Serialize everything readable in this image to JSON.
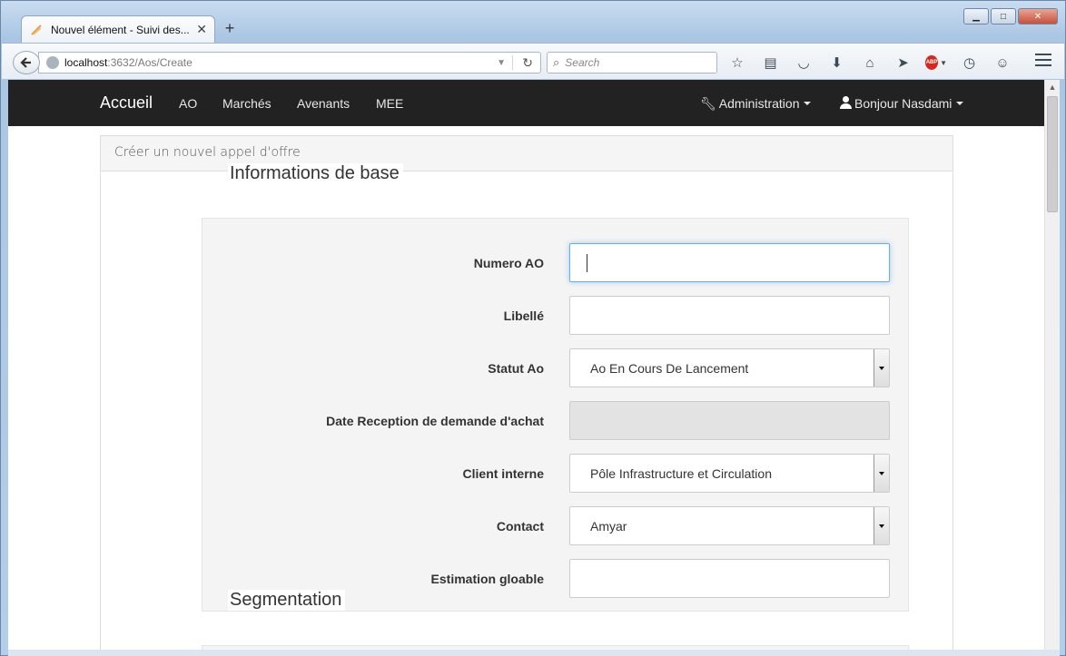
{
  "browser": {
    "tab_title": "Nouvel élément - Suivi des...",
    "new_tab": "+",
    "url_host": "localhost",
    "url_path": ":3632/Aos/Create",
    "search_placeholder": "Search",
    "toolbar_icons": [
      "star-icon",
      "reading-list-icon",
      "pocket-icon",
      "download-icon",
      "home-icon",
      "send-icon",
      "adblock-icon",
      "sync-icon",
      "chat-icon"
    ],
    "abp_label": "ABP"
  },
  "navbar": {
    "brand": "Accueil",
    "items": [
      "AO",
      "Marchés",
      "Avenants",
      "MEE"
    ],
    "admin": "Administration",
    "user": "Bonjour Nasdami"
  },
  "panel": {
    "heading": "Créer un nouvel appel d'offre"
  },
  "section1": {
    "legend": "Informations de base",
    "fields": [
      {
        "label": "Numero AO",
        "value": "",
        "type": "text",
        "focused": true
      },
      {
        "label": "Libellé",
        "value": "",
        "type": "text"
      },
      {
        "label": "Statut Ao",
        "value": "Ao En Cours De Lancement",
        "type": "select"
      },
      {
        "label": "Date Reception de demande d'achat",
        "value": "",
        "type": "disabled"
      },
      {
        "label": "Client interne",
        "value": "Pôle Infrastructure et Circulation",
        "type": "select"
      },
      {
        "label": "Contact",
        "value": "Amyar",
        "type": "select"
      },
      {
        "label": "Estimation gloable",
        "value": "",
        "type": "text"
      }
    ]
  },
  "section2": {
    "legend": "Segmentation"
  },
  "colors": {
    "navbar_bg": "#222222",
    "focus_border": "#66afe9"
  }
}
